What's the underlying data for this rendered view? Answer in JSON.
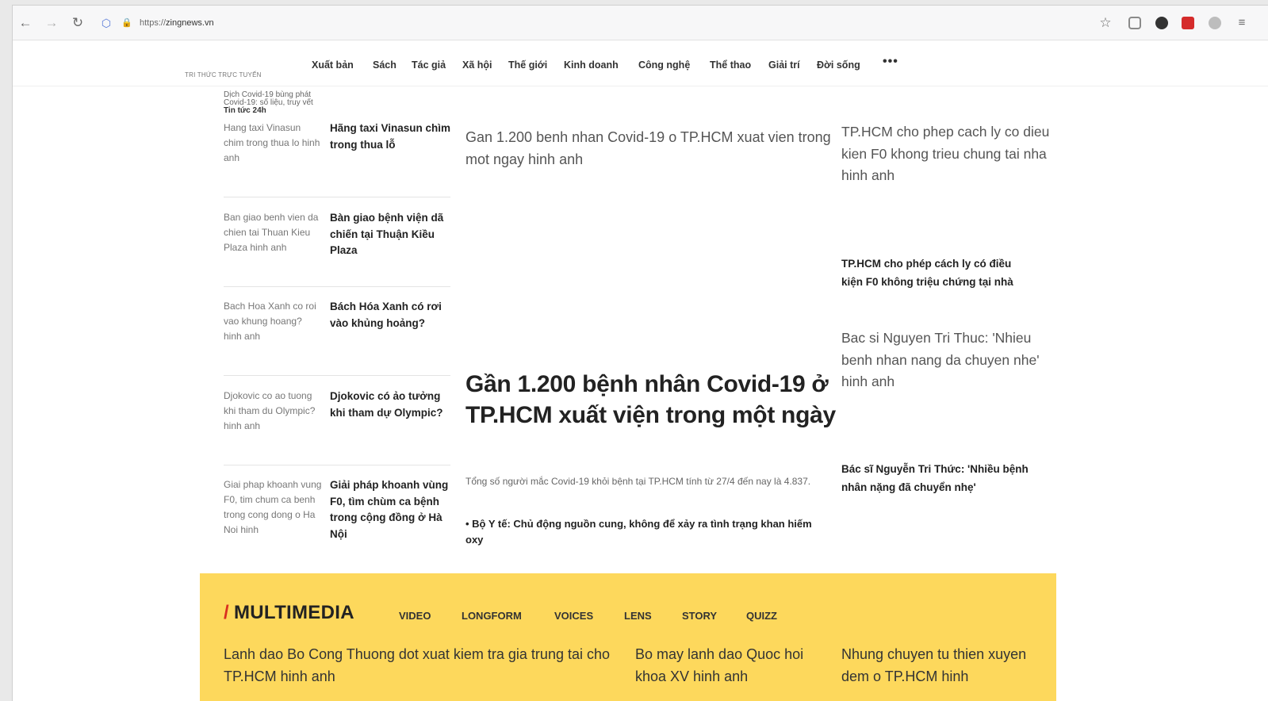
{
  "browser": {
    "back_icon": "←",
    "forward_icon": "→",
    "reload_icon": "↻",
    "shield_icon": "⬡",
    "lock_icon": "🔒",
    "url_scheme": "https://",
    "url_host": "zingnews.vn",
    "star_icon": "☆",
    "menu_icon": "≡"
  },
  "site": {
    "tagline": "TRI THỨC TRỰC TUYẾN"
  },
  "nav": {
    "items": [
      "Xuất bản",
      "Sách",
      "Tác giả",
      "Xã hội",
      "Thế giới",
      "Kinh doanh",
      "Công nghệ",
      "Thể thao",
      "Giải trí",
      "Đời sống"
    ],
    "more": "•••"
  },
  "left": {
    "breaking_line1": "Dịch Covid-19 bùng phát",
    "breaking_line2": "Covid-19: số liệu, truy vết",
    "live_label": "Tin tức 24h",
    "stories": [
      {
        "alt": "Hang taxi Vinasun chim trong thua lo hinh anh",
        "title": "Hãng taxi Vinasun chìm trong thua lỗ"
      },
      {
        "alt": "Ban giao benh vien da chien tai Thuan Kieu Plaza hinh anh",
        "title": "Bàn giao bệnh viện dã chiến tại Thuận Kiều Plaza"
      },
      {
        "alt": "Bach Hoa Xanh co roi vao khung hoang? hinh anh",
        "title": "Bách Hóa Xanh có rơi vào khủng hoảng?"
      },
      {
        "alt": "Djokovic co ao tuong khi tham du Olympic? hinh anh",
        "title": "Djokovic có ảo tưởng khi tham dự Olympic?"
      },
      {
        "alt": "Giai phap khoanh vung F0, tim chum ca benh trong cong dong o Ha Noi hinh",
        "title": "Giải pháp khoanh vùng F0, tìm chùm ca bệnh trong cộng đồng ở Hà Nội"
      }
    ]
  },
  "center": {
    "image_alt": "Gan 1.200 benh nhan Covid-19 o TP.HCM xuat vien trong mot ngay hinh anh",
    "title": "Gần 1.200 bệnh nhân Covid-19 ở TP.HCM xuất viện trong một ngày",
    "summary": "Tổng số người mắc Covid-19 khỏi bệnh tại TP.HCM tính từ 27/4 đến nay là 4.837.",
    "related": "• Bộ Y tế: Chủ động nguồn cung, không để xảy ra tình trạng khan hiếm oxy"
  },
  "right": {
    "story1_alt": "TP.HCM cho phep cach ly co dieu kien F0 khong trieu chung tai nha hinh anh",
    "story1_title": "TP.HCM cho phép cách ly có điều kiện F0 không triệu chứng tại nhà",
    "story2_alt": "Bac si Nguyen Tri Thuc: 'Nhieu benh nhan nang da chuyen nhe' hinh anh",
    "story2_title": "Bác sĩ Nguyễn Tri Thức: 'Nhiều bệnh nhân nặng đã chuyển nhẹ'"
  },
  "multimedia": {
    "slash": "/",
    "title": "MULTIMEDIA",
    "tabs": [
      "VIDEO",
      "LONGFORM",
      "VOICES",
      "LENS",
      "STORY",
      "QUIZZ"
    ],
    "items": [
      "Lanh dao Bo Cong Thuong dot xuat kiem tra gia trung tai cho TP.HCM hinh anh",
      "Bo may lanh dao Quoc hoi khoa XV hinh anh",
      "Nhung chuyen tu thien xuyen dem o TP.HCM hinh"
    ],
    "accent": "#fdd85c",
    "slash_color": "#d92e1f"
  }
}
